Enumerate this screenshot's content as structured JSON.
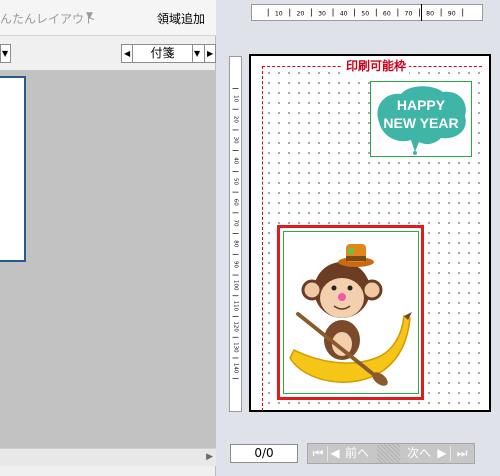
{
  "toolbar": {
    "easy_layout_label": "んたんレイアウト",
    "add_region_label": "領域追加"
  },
  "navigator": {
    "selected": "付箋"
  },
  "rulers": {
    "horizontal_labels": [
      "10",
      "20",
      "30",
      "40",
      "50",
      "60",
      "70",
      "80",
      "90"
    ],
    "vertical_labels": [
      "10",
      "20",
      "30",
      "40",
      "50",
      "60",
      "70",
      "80",
      "90",
      "100",
      "110",
      "120",
      "130",
      "140"
    ]
  },
  "canvas": {
    "print_frame_label": "印刷可能枠",
    "sticker_text": [
      "HAPPY",
      "NEW YEAR"
    ]
  },
  "pager": {
    "counter": "0/0",
    "prev_label": "前へ",
    "next_label": "次へ"
  },
  "colors": {
    "print_frame": "#d0021b",
    "selection": "#e01b1b",
    "region_outline": "#2aa845",
    "thumbnail_border": "#245a97",
    "sticker_fill": "#3fb5a8"
  },
  "icons": {
    "easy_layout": "chevron-down-icon",
    "prev_page": "chevron-left-icon",
    "next_page": "chevron-right-icon",
    "first": "first-page-icon",
    "last": "last-page-icon"
  }
}
